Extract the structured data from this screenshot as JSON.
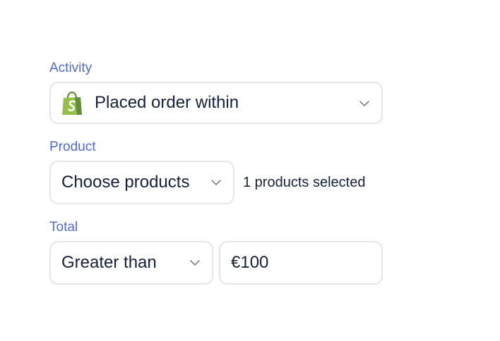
{
  "activity": {
    "label": "Activity",
    "icon": "shopify-bag-icon",
    "value": "Placed order within"
  },
  "product": {
    "label": "Product",
    "value": "Choose products",
    "selection_note": "1 products selected"
  },
  "total": {
    "label": "Total",
    "comparator": "Greater than",
    "amount": "€100"
  },
  "colors": {
    "label": "#4f6ad8",
    "text": "#15213a",
    "border": "#e3e5ea",
    "shopify_green": "#95bf47",
    "shopify_dark": "#5e8e3e"
  }
}
